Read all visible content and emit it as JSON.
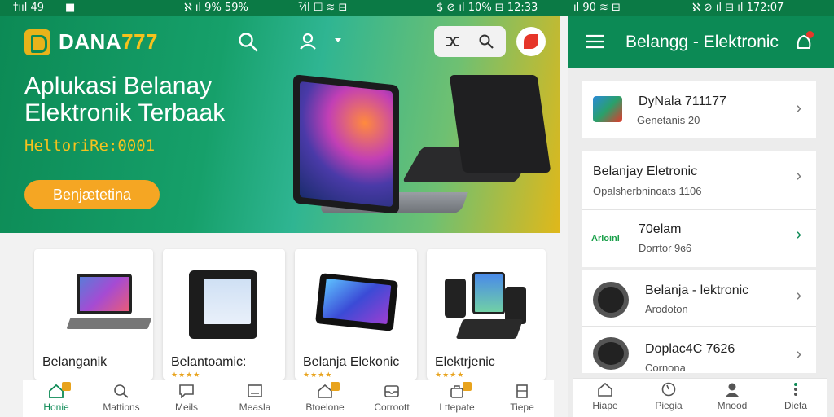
{
  "status_bar": {
    "segments": [
      "†ııl 49",
      "■",
      "ℵ ıl 9% 59%",
      "⁷⁄ıl ☐ ≋ ⊟",
      "$ ⊘ ıl 10% ⊟ 12:33",
      "ıl 90 ≋ ⊟",
      "ℵ ⊘ ıl ⊟ ıl 172:07"
    ]
  },
  "main": {
    "logo": {
      "word": "DANA",
      "digits": "777"
    },
    "hero": {
      "title": "Aplukasi Belanay Elektronik Terbaak",
      "subtitle": "HeltoriRe:0001",
      "button_label": "Benjætetina"
    },
    "cards": [
      {
        "label": "Belanganik",
        "stars": ""
      },
      {
        "label": "Belantoamic:",
        "stars": "★★★★"
      },
      {
        "label": "Belanja Elekonic",
        "stars": "★★★★"
      },
      {
        "label": "Elektrjenic",
        "stars": "★★★★"
      }
    ],
    "nav": [
      {
        "label": "Honie",
        "icon": "home-icon",
        "active": true,
        "badge": true
      },
      {
        "label": "Mattions",
        "icon": "search-icon",
        "active": false,
        "badge": false
      },
      {
        "label": "Meils",
        "icon": "chat-icon",
        "active": false,
        "badge": false
      },
      {
        "label": "Measla",
        "icon": "message-icon",
        "active": false,
        "badge": false
      },
      {
        "label": "Btoelone",
        "icon": "home-outline-icon",
        "active": false,
        "badge": true
      },
      {
        "label": "Corroott",
        "icon": "inbox-icon",
        "active": false,
        "badge": false
      },
      {
        "label": "Lttepate",
        "icon": "bag-icon",
        "active": false,
        "badge": true
      },
      {
        "label": "Tiepe",
        "icon": "profile-icon",
        "active": false,
        "badge": false
      }
    ]
  },
  "right": {
    "title": "Belangg - Elektronic",
    "items": [
      {
        "title": "DyNala 711177",
        "sub": "Genetanis 20"
      },
      {
        "title": "Belanjay Eletronic",
        "sub": "Opalsherbninoats 1106"
      },
      {
        "title": "70elam",
        "sub": "Dorrtor 9ɞ6",
        "tag": "Arloinl"
      },
      {
        "title": "Belanja - lektronic",
        "sub": "Arodoton"
      },
      {
        "title": "Doplac4C 7626",
        "sub": "Cornona"
      }
    ],
    "nav": [
      {
        "label": "Hiape",
        "icon": "home-icon"
      },
      {
        "label": "Piegia",
        "icon": "compass-icon"
      },
      {
        "label": "Mnood",
        "icon": "person-icon"
      },
      {
        "label": "Dieta",
        "icon": "more-icon"
      }
    ]
  },
  "colors": {
    "brand_green": "#0c8a55",
    "accent_orange": "#f5a623",
    "accent_yellow": "#f6c21d"
  }
}
